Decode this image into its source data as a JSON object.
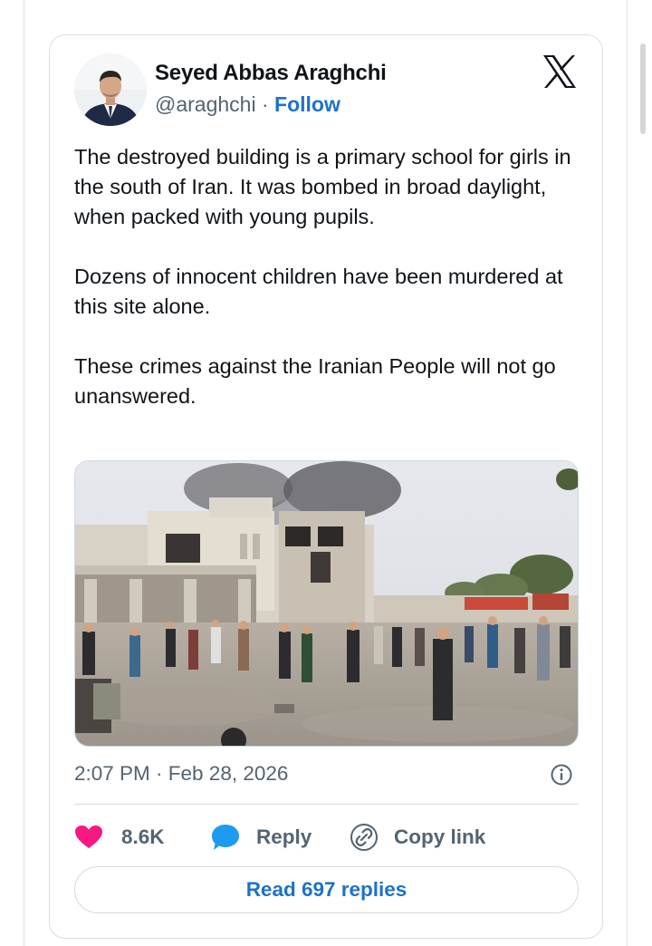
{
  "author": {
    "name": "Seyed Abbas Araghchi",
    "handle": "@araghchi",
    "separator": "·",
    "follow_label": "Follow"
  },
  "brand_icon": "x-logo-icon",
  "tweet": {
    "paragraphs": [
      "The destroyed building is a primary school for girls in the south of Iran. It was bombed in broad daylight, when packed with young pupils.",
      "Dozens of innocent children have been murdered at this site alone.",
      "These crimes against the Iranian People will not go unanswered."
    ],
    "timestamp": "2:07 PM · Feb 28, 2026"
  },
  "actions": {
    "like_count": "8.6K",
    "reply_label": "Reply",
    "copy_label": "Copy link",
    "read_replies_label": "Read 697 replies"
  },
  "colors": {
    "link_blue": "#1d72c8",
    "like_red": "#f91880",
    "reply_blue": "#1d9bf0",
    "muted": "#536471",
    "border": "#cfd9de"
  }
}
